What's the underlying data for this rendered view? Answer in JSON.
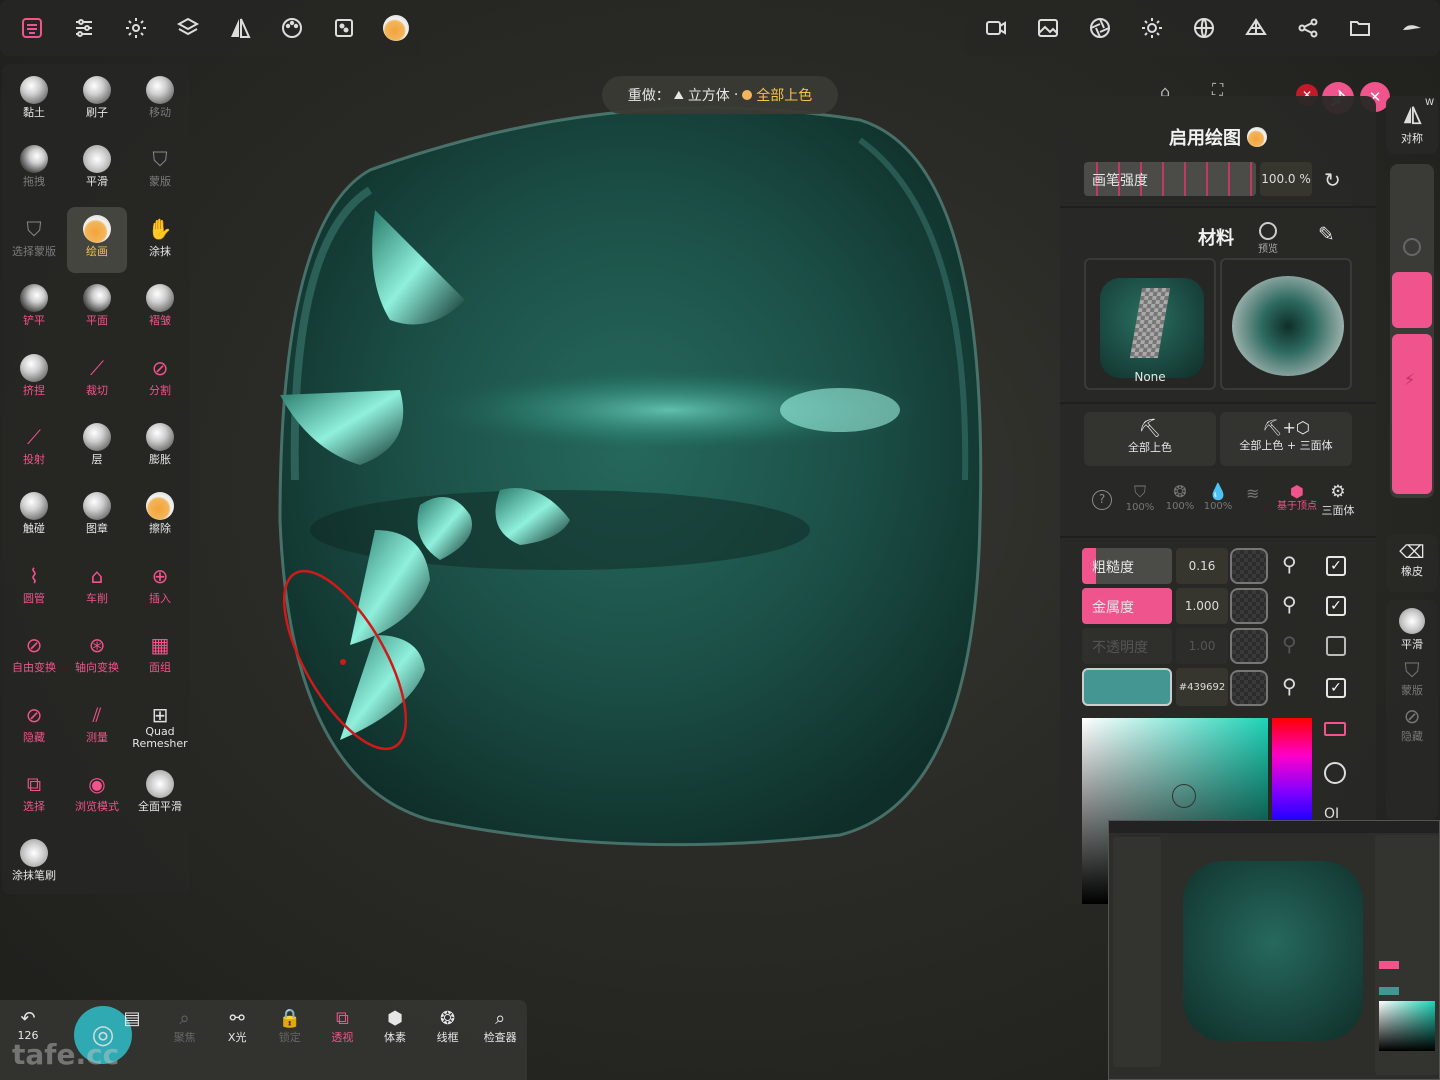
{
  "colors": {
    "accent": "#f0548c",
    "gold": "#f1c14d",
    "paint": "#439692",
    "object": "#1f5c52"
  },
  "top_left_icons": [
    "sculpt-app-icon",
    "sliders-icon",
    "gear-icon",
    "layers-icon",
    "symmetry-icon",
    "palette-icon",
    "scene-icon",
    "paint-ball-icon"
  ],
  "top_right_icons": [
    "video-icon",
    "image-icon",
    "aperture-icon",
    "sun-icon",
    "globe-icon",
    "hierarchy-icon",
    "share-icon",
    "folder-icon",
    "brush-stroke-icon"
  ],
  "tools": [
    {
      "label": "黏土",
      "style": "normal"
    },
    {
      "label": "刷子",
      "style": "normal"
    },
    {
      "label": "移动",
      "style": "dim"
    },
    {
      "label": "拖拽",
      "style": "dim"
    },
    {
      "label": "平滑",
      "style": "normal"
    },
    {
      "label": "蒙版",
      "style": "dim"
    },
    {
      "label": "选择蒙版",
      "style": "dim"
    },
    {
      "label": "绘画",
      "style": "gold"
    },
    {
      "label": "涂抹",
      "style": "normal"
    },
    {
      "label": "铲平",
      "style": "pink"
    },
    {
      "label": "平面",
      "style": "pink"
    },
    {
      "label": "褶皱",
      "style": "pink"
    },
    {
      "label": "挤捏",
      "style": "pink"
    },
    {
      "label": "裁切",
      "style": "pink"
    },
    {
      "label": "分割",
      "style": "pink"
    },
    {
      "label": "投射",
      "style": "pink"
    },
    {
      "label": "层",
      "style": "normal"
    },
    {
      "label": "膨胀",
      "style": "normal"
    },
    {
      "label": "触碰",
      "style": "normal"
    },
    {
      "label": "图章",
      "style": "normal"
    },
    {
      "label": "擦除",
      "style": "normal"
    },
    {
      "label": "圆管",
      "style": "pink"
    },
    {
      "label": "车削",
      "style": "pink"
    },
    {
      "label": "插入",
      "style": "pink"
    },
    {
      "label": "自由变换",
      "style": "pink"
    },
    {
      "label": "轴向变换",
      "style": "pink"
    },
    {
      "label": "面组",
      "style": "pink"
    },
    {
      "label": "隐藏",
      "style": "pink"
    },
    {
      "label": "测量",
      "style": "pink"
    },
    {
      "label": "Quad Remesher",
      "style": "normal"
    },
    {
      "label": "选择",
      "style": "pink"
    },
    {
      "label": "浏览模式",
      "style": "pink"
    },
    {
      "label": "全面平滑",
      "style": "normal"
    },
    {
      "label": "涂抹笔刷",
      "style": "normal"
    }
  ],
  "redo": {
    "prefix": "重做：",
    "shape": "立方体",
    "dot": "·",
    "action": "全部上色"
  },
  "paint_panel": {
    "title": "启用绘图",
    "brush_strength_label": "画笔强度",
    "brush_strength_value": "100.0 %",
    "brush_strength": 1.0,
    "material_label": "材料",
    "preview_label": "预览",
    "material_name": "None",
    "paint_all": "全部上色",
    "paint_all_plus": "全部上色 + 三面体",
    "percent_a": "100%",
    "percent_b": "100%",
    "percent_c": "100%",
    "vertex_based": "基于顶点",
    "triplanar": "三面体",
    "roughness_label": "粗糙度",
    "roughness_value": "0.16",
    "roughness": 0.16,
    "metalness_label": "金属度",
    "metalness_value": "1.000",
    "metalness": 1.0,
    "opacity_label": "不透明度",
    "opacity_value": "1.00",
    "color_hex": "#439692"
  },
  "right_sidebar": {
    "symmetry_label": "对称",
    "symmetry_sup": "W",
    "eraser_label": "橡皮",
    "smooth_label": "平滑",
    "mask_label": "蒙版",
    "hide_label": "隐藏"
  },
  "bottom_bar": {
    "undo_count": "126",
    "watermark": "tafe.cc",
    "items": [
      {
        "label": "",
        "icon": "pages-icon",
        "style": "normal"
      },
      {
        "label": "聚焦",
        "icon": "search-icon",
        "style": "dim"
      },
      {
        "label": "X光",
        "icon": "xray-icon",
        "style": "normal"
      },
      {
        "label": "锁定",
        "icon": "lock-icon",
        "style": "dim"
      },
      {
        "label": "透视",
        "icon": "perspective-icon",
        "style": "pink"
      },
      {
        "label": "体素",
        "icon": "voxel-icon",
        "style": "normal"
      },
      {
        "label": "线框",
        "icon": "wireframe-icon",
        "style": "normal"
      },
      {
        "label": "检查器",
        "icon": "inspector-icon",
        "style": "normal"
      }
    ]
  }
}
